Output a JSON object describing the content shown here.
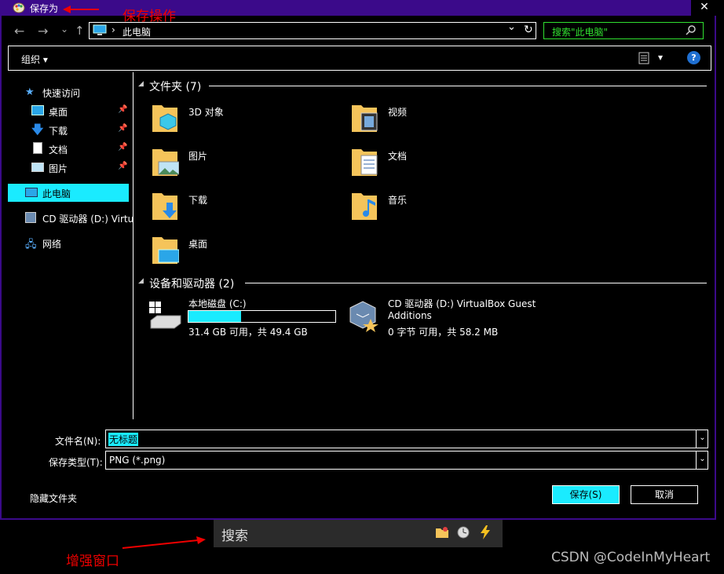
{
  "window": {
    "title": "保存为",
    "close_glyph": "✕"
  },
  "annotations": {
    "save_op": "保存操作",
    "enhance_window": "增强窗口",
    "watermark": "CSDN @CodeInMyHeart"
  },
  "nav": {
    "back_glyph": "←",
    "forward_glyph": "→",
    "dropdown_glyph": "⌄",
    "up_glyph": "↑",
    "address_sep": "›",
    "address": "此电脑",
    "refresh_glyph": "↻",
    "search_placeholder": "搜索\"此电脑\""
  },
  "toolbar": {
    "organize": "组织 ▾",
    "view_caret": "▾",
    "help_glyph": "?"
  },
  "sidebar": {
    "quick_access": "快速访问",
    "items": [
      {
        "label": "桌面"
      },
      {
        "label": "下载"
      },
      {
        "label": "文档"
      },
      {
        "label": "图片"
      }
    ],
    "this_pc": "此电脑",
    "cd_drive": "CD 驱动器 (D:) Virtu",
    "network": "网络"
  },
  "folders_section": {
    "header": "文件夹 (7)",
    "items": [
      {
        "label": "3D 对象"
      },
      {
        "label": "视频"
      },
      {
        "label": "图片"
      },
      {
        "label": "文档"
      },
      {
        "label": "下载"
      },
      {
        "label": "音乐"
      },
      {
        "label": "桌面"
      }
    ]
  },
  "devices_section": {
    "header": "设备和驱动器 (2)",
    "local_disk": {
      "name": "本地磁盘 (C:)",
      "usage": "31.4 GB 可用，共 49.4 GB",
      "used_fraction": 0.36
    },
    "cd_drive": {
      "name_line1": "CD 驱动器 (D:) VirtualBox Guest",
      "name_line2": "Additions",
      "usage": "0 字节 可用，共 58.2 MB"
    }
  },
  "form": {
    "filename_label": "文件名(N):",
    "filename_value": "无标题",
    "filetype_label": "保存类型(T):",
    "filetype_value": "PNG (*.png)",
    "hide_folders": "隐藏文件夹",
    "save_button": "保存(S)",
    "cancel_button": "取消"
  },
  "enhance_bar": {
    "search_text": "搜索"
  },
  "colors": {
    "title_bar": "#3b0a8a",
    "accent": "#1aebff",
    "folder": "#f5c45a",
    "annotation_red": "#e00000"
  }
}
